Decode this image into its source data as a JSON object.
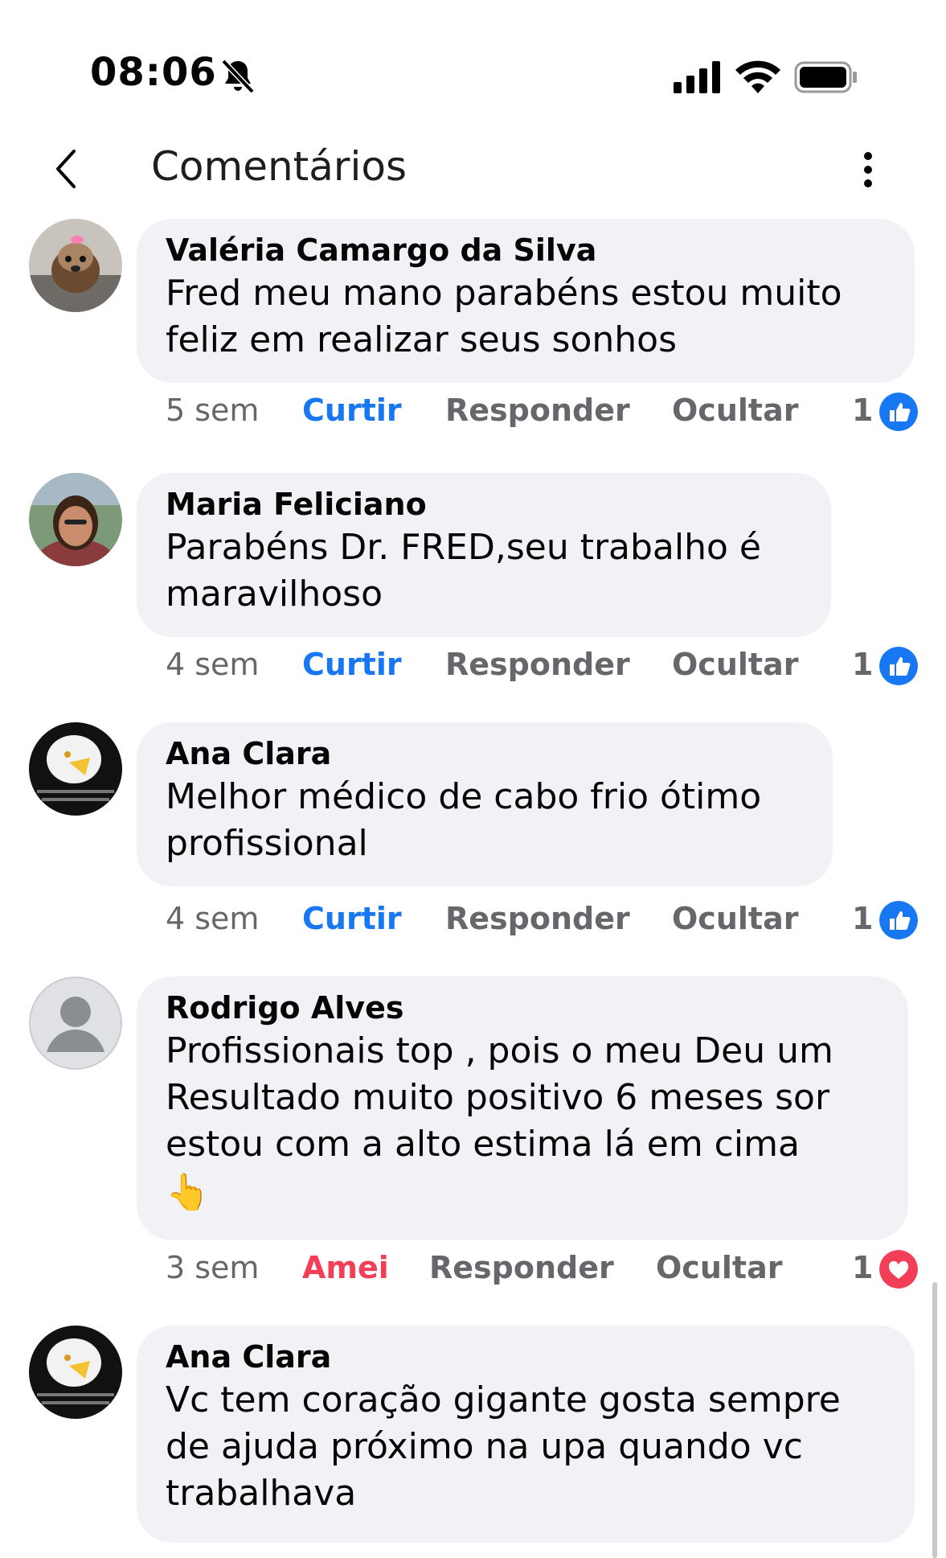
{
  "status": {
    "time": "08:06"
  },
  "header": {
    "title": "Comentários"
  },
  "comments": [
    {
      "name": "Valéria Camargo da Silva",
      "text": "Fred meu mano parabéns estou muito feliz em realizar seus sonhos",
      "time": "5 sem",
      "reaction_action": "Curtir",
      "reply": "Responder",
      "hide": "Ocultar",
      "count": "1",
      "reaction": "like-icon"
    },
    {
      "name": "Maria Feliciano",
      "text": "Parabéns Dr. FRED,seu trabalho é maravilhoso",
      "time": "4 sem",
      "reaction_action": "Curtir",
      "reply": "Responder",
      "hide": "Ocultar",
      "count": "1",
      "reaction": "like-icon"
    },
    {
      "name": "Ana Clara",
      "text": "Melhor médico de cabo frio ótimo profissional",
      "time": "4 sem",
      "reaction_action": "Curtir",
      "reply": "Responder",
      "hide": "Ocultar",
      "count": "1",
      "reaction": "like-icon"
    },
    {
      "name": "Rodrigo Alves",
      "text": "Profissionais top , pois o meu Deu um Resultado muito positivo 6 meses sor estou com a alto estima lá em cima",
      "emoji": "👆",
      "time": "3 sem",
      "reaction_action": "Amei",
      "reply": "Responder",
      "hide": "Ocultar",
      "count": "1",
      "reaction": "heart-icon"
    },
    {
      "name": "Ana Clara",
      "text": "Vc tem coração gigante gosta sempre de ajuda próximo na upa quando vc trabalhava"
    }
  ],
  "colors": {
    "like_blue": "#1877f2",
    "love_red": "#f33e58",
    "bubble": "#f0f2f5",
    "meta_gray": "#65676b"
  }
}
